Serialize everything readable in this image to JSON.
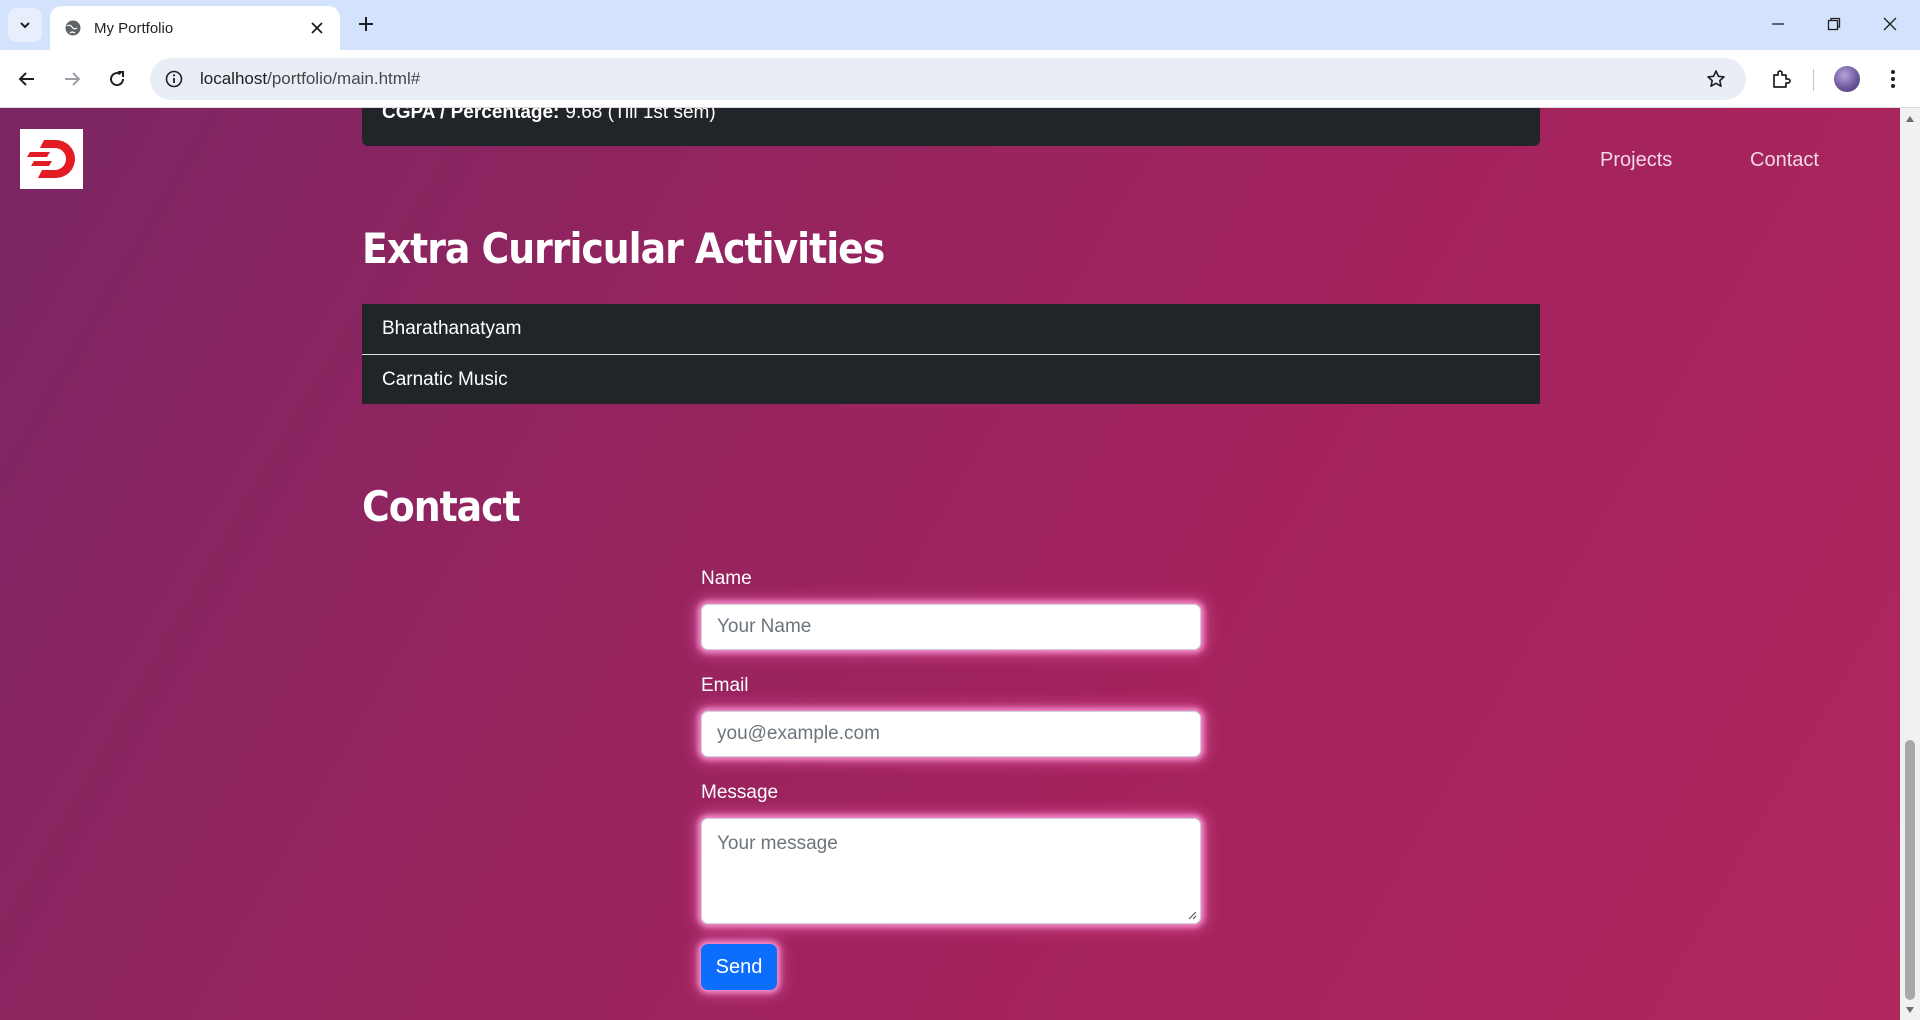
{
  "browser": {
    "tab_title": "My Portfolio",
    "url_host": "localhost",
    "url_path": "/portfolio/main.html#"
  },
  "icons": {
    "tab_list": "chevron-down-icon",
    "favicon": "globe-icon",
    "tab_close": "close-icon",
    "new_tab": "plus-icon",
    "back": "arrow-left-icon",
    "forward": "arrow-right-icon",
    "reload": "reload-icon",
    "site_info": "site-info-icon",
    "bookmark": "star-icon",
    "extensions": "puzzle-icon",
    "menu": "kebab-menu-icon"
  },
  "nav": {
    "links": [
      {
        "label": "Projects"
      },
      {
        "label": "Contact"
      }
    ]
  },
  "education": {
    "cgpa_label": "CGPA / Percentage:",
    "cgpa_value": "9.68 (Till 1st sem)"
  },
  "extracurricular": {
    "heading": "Extra Curricular Activities",
    "items": [
      "Bharathanatyam",
      "Carnatic Music"
    ]
  },
  "contact": {
    "heading": "Contact",
    "name_label": "Name",
    "name_placeholder": "Your Name",
    "email_label": "Email",
    "email_placeholder": "you@example.com",
    "message_label": "Message",
    "message_placeholder": "Your message",
    "send_label": "Send"
  },
  "colors": {
    "accent_button": "#0d6efd",
    "card_bg": "#212529",
    "logo_red": "#e31b23",
    "glow": "#ff8fd6"
  }
}
